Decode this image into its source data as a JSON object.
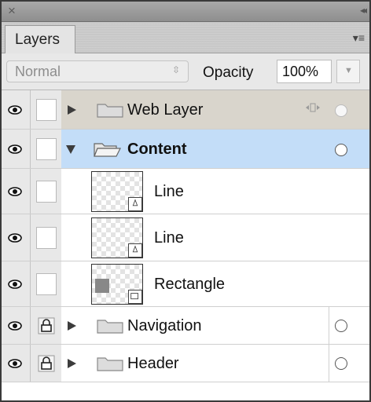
{
  "panel": {
    "tab_label": "Layers"
  },
  "window": {
    "close_glyph": "×",
    "collapse_glyph": "◂◂",
    "menu_glyph": "▾≡"
  },
  "controls": {
    "blend_mode": "Normal",
    "blend_arrows": "⇳",
    "opacity_label": "Opacity",
    "opacity_value": "100%",
    "opacity_arrow": "▼"
  },
  "layers": [
    {
      "name": "Web Layer",
      "type": "group",
      "visible": true,
      "locked": false,
      "expanded": false,
      "state": "highlighted",
      "extra_icon": "web-layer-icon"
    },
    {
      "name": "Content",
      "type": "group",
      "visible": true,
      "locked": false,
      "expanded": true,
      "state": "selected"
    },
    {
      "name": "Line",
      "type": "line",
      "visible": true,
      "locked": false,
      "indent": 1
    },
    {
      "name": "Line",
      "type": "line",
      "visible": true,
      "locked": false,
      "indent": 1
    },
    {
      "name": "Rectangle",
      "type": "rectangle",
      "visible": true,
      "locked": false,
      "indent": 1
    },
    {
      "name": "Navigation",
      "type": "group",
      "visible": true,
      "locked": true,
      "expanded": false
    },
    {
      "name": "Header",
      "type": "group",
      "visible": true,
      "locked": true,
      "expanded": false
    }
  ],
  "colors": {
    "selected_row": "#c3ddf8",
    "highlight_row": "#d9d5cc",
    "panel_bg": "#e8e8e8"
  }
}
